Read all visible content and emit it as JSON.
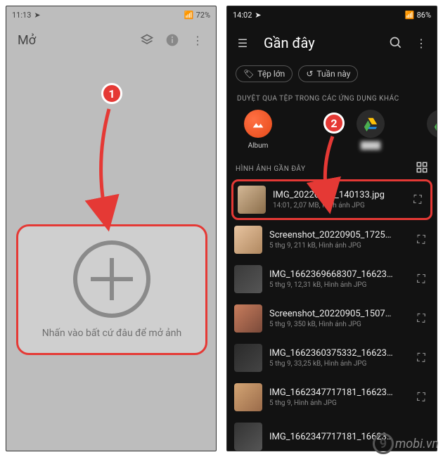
{
  "left": {
    "status": {
      "time": "11:13",
      "battery": "72%"
    },
    "title": "Mở",
    "open_hint": "Nhấn vào bất cứ đâu để mở ảnh"
  },
  "right": {
    "status": {
      "time": "14:02",
      "battery": "86%"
    },
    "title": "Gần đây",
    "chips": {
      "large": "Tệp lớn",
      "week": "Tuần này"
    },
    "browse_label": "DUYỆT QUA TỆP TRONG CÁC ỨNG DỤNG KHÁC",
    "apps": {
      "album": "Album"
    },
    "recent_label": "HÌNH ẢNH GẦN ĐÂY",
    "files": [
      {
        "name": "IMG_20220906_140133.jpg",
        "meta": "14:01, 2,07 MB, Hình ảnh JPG"
      },
      {
        "name": "Screenshot_20220905_1725…",
        "meta": "5 thg 9, 211 kB, Hình ảnh JPG"
      },
      {
        "name": "IMG_1662369668307_16623…",
        "meta": "5 thg 9, 12,31 kB, Hình ảnh JPG"
      },
      {
        "name": "Screenshot_20220905_1507…",
        "meta": "5 thg 9, 350 kB, Hình ảnh JPG"
      },
      {
        "name": "IMG_1662360375332_16623…",
        "meta": "5 thg 9, 33,25 kB, Hình ảnh JPG"
      },
      {
        "name": "IMG_1662347717181_16623…",
        "meta": "5 thg 9, Hình ảnh JPG"
      },
      {
        "name": "IMG_1662347717181_16623…",
        "meta": ""
      }
    ]
  },
  "annotations": {
    "badge1": "1",
    "badge2": "2"
  },
  "watermark": {
    "nine": "9",
    "text": "mobi.vn"
  }
}
